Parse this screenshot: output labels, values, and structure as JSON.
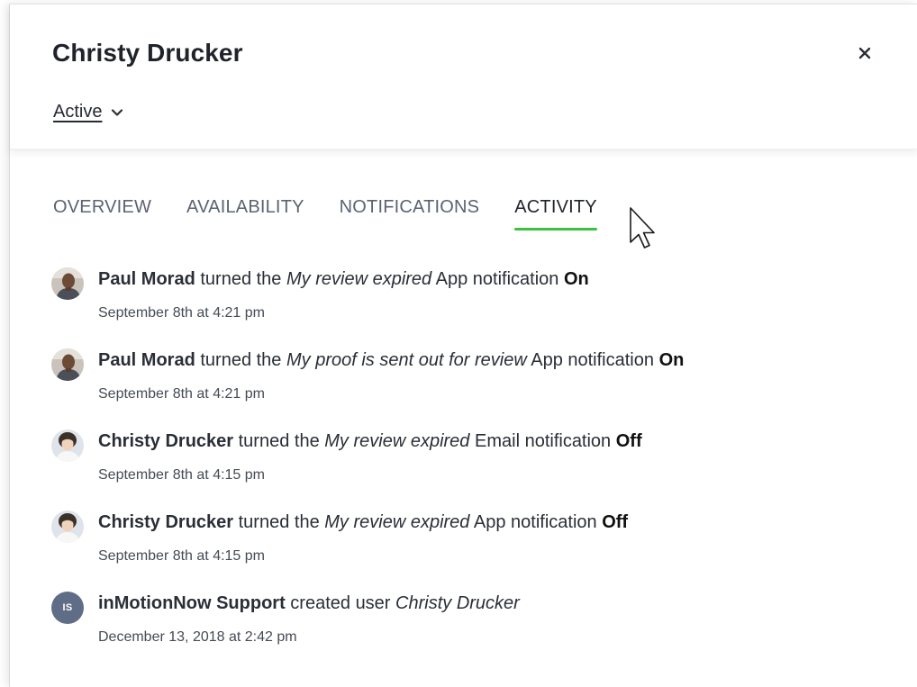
{
  "user": {
    "name": "Christy Drucker",
    "status": "Active"
  },
  "tabs": [
    {
      "label": "OVERVIEW",
      "active": false
    },
    {
      "label": "AVAILABILITY",
      "active": false
    },
    {
      "label": "NOTIFICATIONS",
      "active": false
    },
    {
      "label": "ACTIVITY",
      "active": true
    }
  ],
  "activity": [
    {
      "actor": "Paul Morad",
      "verb": "turned the",
      "subject": "My review expired",
      "detail": "App notification",
      "state": "On",
      "time": "September 8th at 4:21 pm",
      "avatar": "photo-paul"
    },
    {
      "actor": "Paul Morad",
      "verb": "turned the",
      "subject": "My proof is sent out for review",
      "detail": "App notification",
      "state": "On",
      "time": "September 8th at 4:21 pm",
      "avatar": "photo-paul"
    },
    {
      "actor": "Christy Drucker",
      "verb": "turned the",
      "subject": "My review expired",
      "detail": "Email notification",
      "state": "Off",
      "time": "September 8th at 4:15 pm",
      "avatar": "photo-christy"
    },
    {
      "actor": "Christy Drucker",
      "verb": "turned the",
      "subject": "My review expired",
      "detail": "App notification",
      "state": "Off",
      "time": "September 8th at 4:15 pm",
      "avatar": "photo-christy"
    },
    {
      "actor": "inMotionNow Support",
      "verb": "created user",
      "subject": "Christy Drucker",
      "detail": "",
      "state": "",
      "time": "December 13, 2018 at 2:42 pm",
      "avatar": "initials",
      "initials": "IS"
    }
  ],
  "icons": {
    "close": "close-icon",
    "status_dropdown": "chevron-down-icon",
    "pointer": "mouse-cursor-icon"
  },
  "colors": {
    "active_tab_underline": "#3cc13c",
    "initials_avatar": "#5f6e86"
  }
}
